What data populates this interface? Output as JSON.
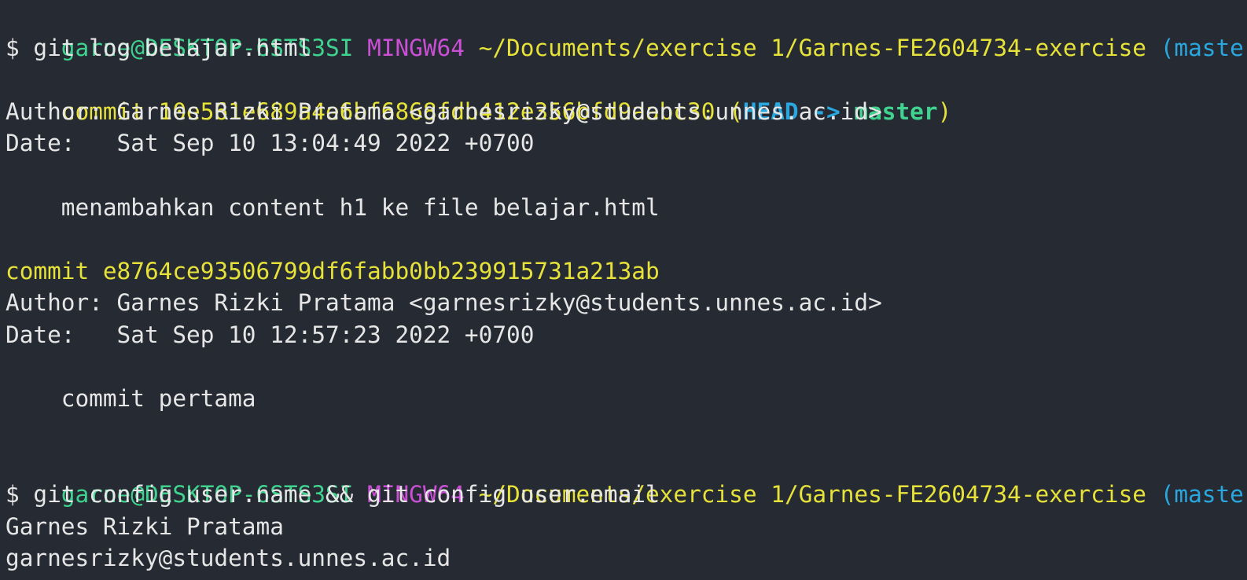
{
  "prompt1": {
    "user_host": "garne@DESKTOP-6STS3SI",
    "shell": "MINGW64",
    "path": "~/Documents/exercise 1/Garnes-FE2604734-exercise",
    "branch": "(master)"
  },
  "command1": "$ git log belajar.html",
  "commit1": {
    "hash_line": "commit 10e561e689a4e6bf6868fdb412e356bfd9aabc30",
    "ref_open": " (",
    "head": "HEAD -> ",
    "ref_branch": "master",
    "ref_close": ")",
    "author": "Author: Garnes Rizki Pratama <garnesrizky@students.unnes.ac.id>",
    "date": "Date:   Sat Sep 10 13:04:49 2022 +0700",
    "message": "    menambahkan content h1 ke file belajar.html"
  },
  "commit2": {
    "hash_line": "commit e8764ce93506799df6fabb0bb239915731a213ab",
    "author": "Author: Garnes Rizki Pratama <garnesrizky@students.unnes.ac.id>",
    "date": "Date:   Sat Sep 10 12:57:23 2022 +0700",
    "message": "    commit pertama"
  },
  "prompt2": {
    "user_host": "garne@DESKTOP-6STS3SI",
    "shell": "MINGW64",
    "path": "~/Documents/exercise 1/Garnes-FE2604734-exercise",
    "branch": "(master)"
  },
  "command2": "$ git config user.name && git config user.email",
  "output": {
    "name": "Garnes Rizki Pratama",
    "email": "garnesrizky@students.unnes.ac.id"
  },
  "colors": {
    "background": "#262a33",
    "user_host": "#3fd38f",
    "shell": "#c94fd4",
    "path": "#e6e23a",
    "branch": "#2aa7df",
    "text": "#e6e6e6"
  }
}
